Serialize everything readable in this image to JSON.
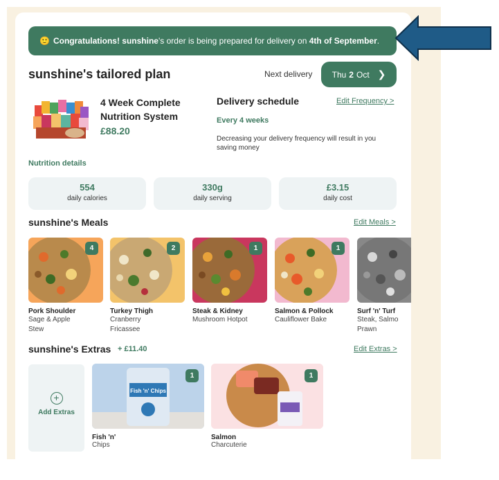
{
  "banner": {
    "emoji": "🙂",
    "congrats": "Congratulations!",
    "name": "sunshine",
    "middle": "'s order is being prepared for delivery on",
    "date": "4th of September",
    "end": "."
  },
  "plan": {
    "title": "sunshine's tailored plan",
    "next_label": "Next delivery",
    "next_day": "Thu",
    "next_num": "2",
    "next_month": "Oct"
  },
  "product": {
    "name": "4 Week Complete Nutrition System",
    "price": "£88.20"
  },
  "delivery": {
    "title": "Delivery schedule",
    "edit_label": "Edit Frequency >",
    "frequency": "Every 4 weeks",
    "note": "Decreasing your delivery frequency will result in you saving money"
  },
  "nutrition": {
    "label": "Nutrition details",
    "stats": [
      {
        "value": "554",
        "label": "daily calories"
      },
      {
        "value": "330g",
        "label": "daily serving"
      },
      {
        "value": "£3.15",
        "label": "daily cost"
      }
    ]
  },
  "meals": {
    "title": "sunshine's Meals",
    "edit_label": "Edit Meals >",
    "items": [
      {
        "name": "Pork Shoulder",
        "sub1": "Sage & Apple",
        "sub2": "Stew",
        "qty": "4",
        "bg": "#f6a55a"
      },
      {
        "name": "Turkey Thigh",
        "sub1": "Cranberry",
        "sub2": "Fricassee",
        "qty": "2",
        "bg": "#f3c36a"
      },
      {
        "name": "Steak & Kidney",
        "sub1": "Mushroom Hotpot",
        "sub2": "",
        "qty": "1",
        "bg": "#c9375e"
      },
      {
        "name": "Salmon & Pollock",
        "sub1": "Cauliflower Bake",
        "sub2": "",
        "qty": "1",
        "bg": "#f2b9cf"
      },
      {
        "name": "Surf 'n' Turf",
        "sub1": "Steak, Salmo",
        "sub2": "Prawn",
        "qty": "",
        "bg": "#888888"
      }
    ]
  },
  "extras": {
    "title": "sunshine's Extras",
    "price": "+ £11.40",
    "edit_label": "Edit Extras >",
    "add_label": "Add Extras",
    "items": [
      {
        "name": "Fish 'n'",
        "sub": "Chips",
        "qty": "1",
        "bg": "#bcd3ea",
        "pack_text": "Fish 'n' Chips"
      },
      {
        "name": "Salmon",
        "sub": "Charcuterie",
        "qty": "1",
        "bg": "#fbe1e3",
        "pack_text": ""
      }
    ]
  },
  "colors": {
    "brand_green": "#3f7a60",
    "cream": "#f9f1e1",
    "arrow_blue": "#1f5b87"
  }
}
